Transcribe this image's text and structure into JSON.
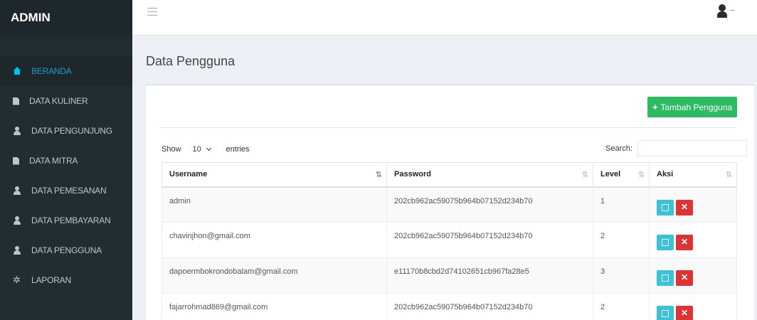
{
  "brand": "ADMIN",
  "sidebar": {
    "items": [
      {
        "label": "BERANDA",
        "icon": "home-icon"
      },
      {
        "label": "DATA KULINER",
        "icon": "file-icon"
      },
      {
        "label": "DATA PENGUNJUNG",
        "icon": "user-icon"
      },
      {
        "label": "DATA MITRA",
        "icon": "file-icon"
      },
      {
        "label": "DATA PEMESANAN",
        "icon": "user-icon"
      },
      {
        "label": "DATA PEMBAYARAN",
        "icon": "user-icon"
      },
      {
        "label": "DATA PENGGUNA",
        "icon": "user-icon"
      },
      {
        "label": "LAPORAN",
        "icon": "tools-icon"
      }
    ]
  },
  "page": {
    "title": "Data Pengguna",
    "add_button": "Tambah Pengguna",
    "show_label": "Show",
    "entries_value": "10",
    "entries_label": "entries",
    "search_label": "Search:"
  },
  "table": {
    "headers": [
      "Username",
      "Password",
      "Level",
      "Aksi"
    ],
    "rows": [
      [
        "admin",
        "202cb962ac59075b964b07152d234b70",
        "1"
      ],
      [
        "chavinjhon@gmail.com",
        "202cb962ac59075b964b07152d234b70",
        "2"
      ],
      [
        "dapoermbokrondobalam@gmail.com",
        "e11170b8cbd2d74102651cb967fa28e5",
        "3"
      ],
      [
        "fajarrohmad869@gmail.com",
        "202cb962ac59075b964b07152d234b70",
        "2"
      ]
    ]
  },
  "colors": {
    "sidebar": "#222d32",
    "active_text": "#00c0ef",
    "add_button": "#2cba62",
    "edit_button": "#3ac2d6",
    "delete_button": "#dc3434"
  }
}
